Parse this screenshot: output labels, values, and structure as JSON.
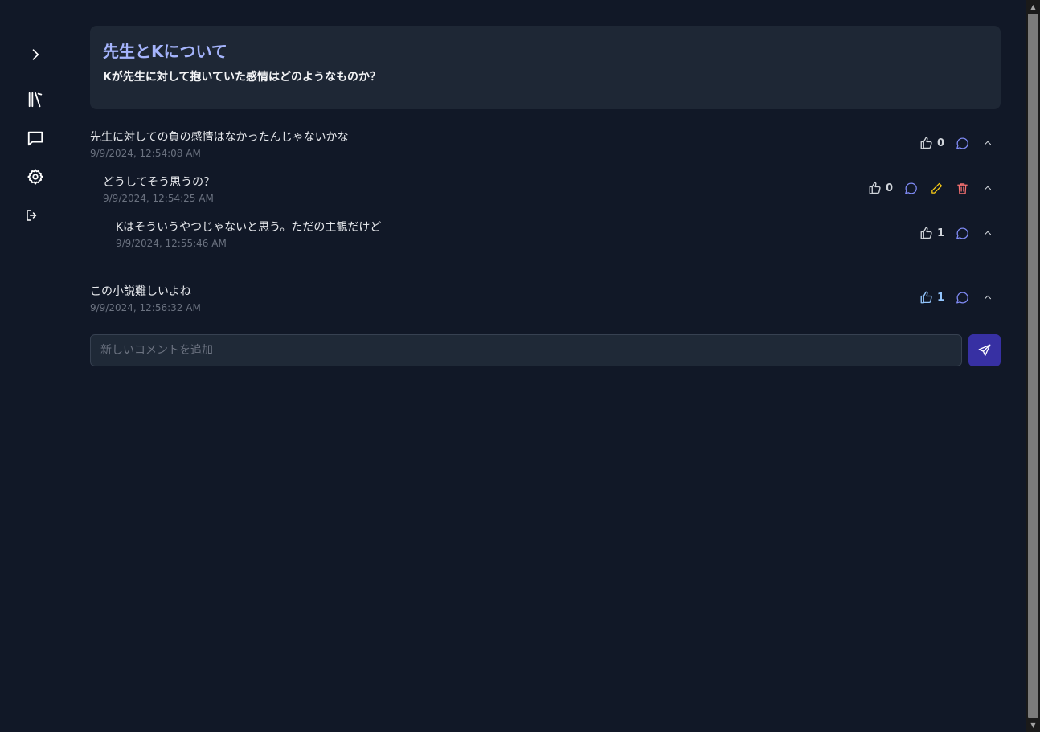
{
  "colors": {
    "background": "#111827",
    "card": "#1e2735",
    "title_accent": "#a5b4fc",
    "reply_icon": "#818cf8",
    "edit_icon": "#facc15",
    "delete_icon": "#f87171",
    "liked_icon": "#93c5fd",
    "send_button": "#3730a3"
  },
  "sidebar": {
    "items": [
      {
        "icon": "chevron-right-icon"
      },
      {
        "icon": "library-icon"
      },
      {
        "icon": "message-square-icon"
      },
      {
        "icon": "settings-gear-icon"
      },
      {
        "icon": "logout-icon"
      }
    ]
  },
  "topic": {
    "title": "先生とKについて",
    "question": "Kが先生に対して抱いていた感情はどのようなものか？"
  },
  "comments": [
    {
      "text": "先生に対しての負の感情はなかったんじゃないかな",
      "timestamp": "9/9/2024, 12:54:08 AM",
      "likes": "0",
      "liked": false,
      "depth": 0
    },
    {
      "text": "どうしてそう思うの？",
      "timestamp": "9/9/2024, 12:54:25 AM",
      "likes": "0",
      "liked": false,
      "depth": 1,
      "editable": true
    },
    {
      "text": "Kはそういうやつじゃないと思う。ただの主観だけど",
      "timestamp": "9/9/2024, 12:55:46 AM",
      "likes": "1",
      "liked": false,
      "depth": 2
    },
    {
      "text": "この小説難しいよね",
      "timestamp": "9/9/2024, 12:56:32 AM",
      "likes": "1",
      "liked": true,
      "depth": 0
    }
  ],
  "new_comment": {
    "placeholder": "新しいコメントを追加",
    "value": ""
  }
}
